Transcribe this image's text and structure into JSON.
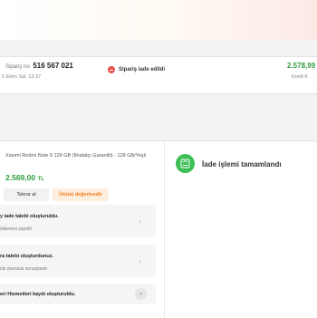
{
  "order": {
    "number_label": "Sipariş no",
    "number": "516 567 021",
    "date": "6 Ekim Sal, 13:37",
    "status": "Sipariş iade edildi",
    "total": "2.578,99",
    "payment": "Kredi K"
  },
  "product": {
    "name": "Xiaomi Redmi Note 9 128 GB (İthalatçı Garantili) - 128 GB/Yeşil",
    "price": "2.569,00",
    "currency": "TL",
    "buy_again": "Tekrar al",
    "review": "Ürünü değerlendir"
  },
  "steps": [
    {
      "title": "y iade talebi oluşturuldu.",
      "subtitle": "ödemesi yapıldı"
    },
    {
      "title": "ra talebi oluşturdunuz.",
      "subtitle": "niz olumsuz sonuçlandı"
    },
    {
      "title": "eri Hizmetleri kaydı oluşturuldu."
    }
  ],
  "return_status": {
    "title": "İade işlemi tamamlandı"
  },
  "colors": {
    "green": "#2d9c3c",
    "orange": "#f27a1a",
    "red": "#e8504e",
    "icon_green": "#3cbf54"
  }
}
